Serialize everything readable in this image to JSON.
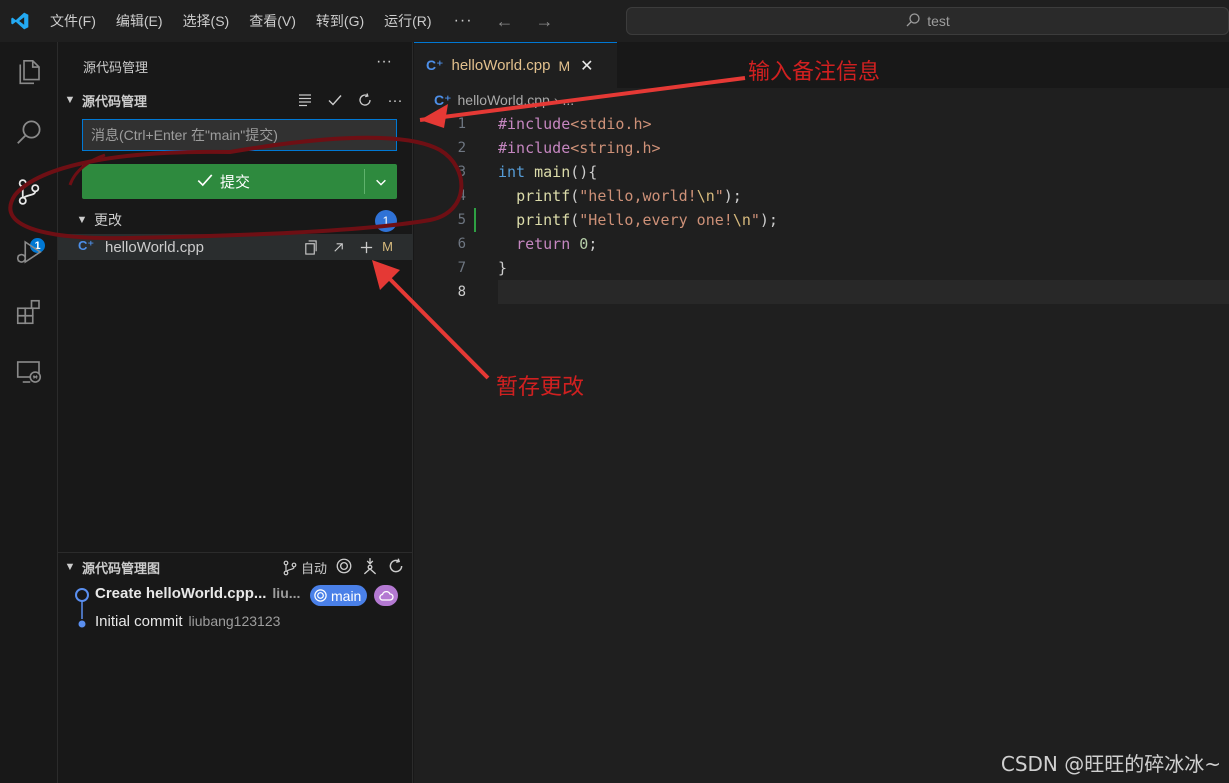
{
  "titlebar": {
    "menus": [
      "文件(F)",
      "编辑(E)",
      "选择(S)",
      "查看(V)",
      "转到(G)",
      "运行(R)"
    ],
    "more": "···",
    "search_text": "test"
  },
  "activitybar": {
    "items": [
      "explorer-icon",
      "search-icon",
      "source-control-icon",
      "run-debug-icon",
      "extensions-icon",
      "remote-explorer-icon"
    ],
    "scm_badge": "1"
  },
  "sidebar": {
    "title": "源代码管理",
    "more": "···",
    "section_label": "源代码管理",
    "message_placeholder": "消息(Ctrl+Enter 在\"main\"提交)",
    "commit_label": "提交",
    "changes_label": "更改",
    "changes_count": "1",
    "file": {
      "name": "helloWorld.cpp",
      "status": "M"
    }
  },
  "graph": {
    "title": "源代码管理图",
    "auto_label": "自动",
    "commits": [
      {
        "message": "Create helloWorld.cpp...",
        "author": "liu..."
      },
      {
        "message": "Initial commit",
        "author": "liubang123123"
      }
    ],
    "branch": "main"
  },
  "editor": {
    "tab_name": "helloWorld.cpp",
    "tab_status": "M",
    "breadcrumb_file": "helloWorld.cpp",
    "breadcrumb_more": "...",
    "line_numbers": [
      "1",
      "2",
      "3",
      "4",
      "5",
      "6",
      "7",
      "8"
    ]
  },
  "annotations": {
    "message_note": "输入备注信息",
    "stage_note": "暂存更改"
  },
  "watermark": "CSDN @旺旺的碎冰冰~",
  "colors": {
    "accent": "#0078d4",
    "commit_button": "#2e8a3e",
    "annotation": "#d02020"
  }
}
